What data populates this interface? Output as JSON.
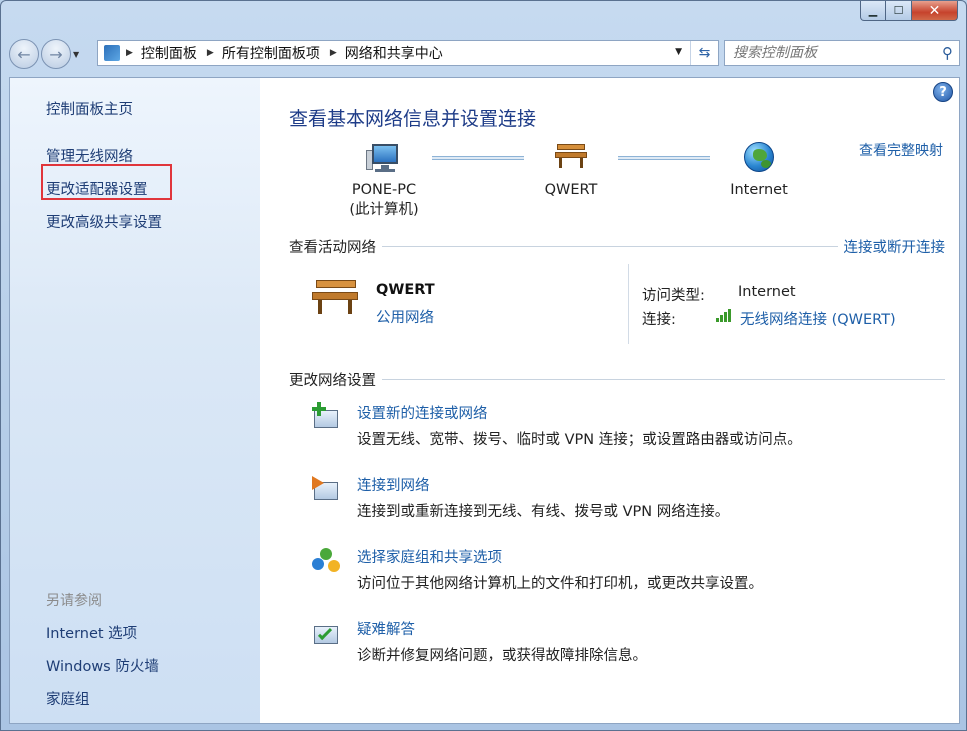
{
  "window": {
    "minimize_glyph": "▁",
    "maximize_glyph": "☐",
    "close_glyph": "✕"
  },
  "nav": {
    "back_glyph": "←",
    "forward_glyph": "→",
    "dropdown_glyph": "▼",
    "breadcrumb": [
      "控制面板",
      "所有控制面板项",
      "网络和共享中心"
    ],
    "breadcrumb_sep": "▶",
    "refresh_glyph": "⇆",
    "search_placeholder": "搜索控制面板",
    "search_glyph": "⚲"
  },
  "sidebar": {
    "home": "控制面板主页",
    "links": [
      "管理无线网络",
      "更改适配器设置",
      "更改高级共享设置"
    ],
    "see_also_header": "另请参阅",
    "see_also": [
      "Internet 选项",
      "Windows 防火墙",
      "家庭组"
    ]
  },
  "main": {
    "help_glyph": "?",
    "title": "查看基本网络信息并设置连接",
    "full_map_link": "查看完整映射",
    "nodes": [
      {
        "label": "PONE-PC",
        "sublabel": "(此计算机)",
        "icon": "computer-icon"
      },
      {
        "label": "QWERT",
        "sublabel": "",
        "icon": "bench-network-icon"
      },
      {
        "label": "Internet",
        "sublabel": "",
        "icon": "globe-icon"
      }
    ],
    "active_header": "查看活动网络",
    "active_link": "连接或断开连接",
    "network": {
      "name": "QWERT",
      "type": "公用网络",
      "access_label": "访问类型:",
      "access_value": "Internet",
      "conn_label": "连接:",
      "conn_value": "无线网络连接 (QWERT)"
    },
    "change_header": "更改网络设置",
    "tasks": [
      {
        "title": "设置新的连接或网络",
        "desc": "设置无线、宽带、拨号、临时或 VPN 连接；或设置路由器或访问点。",
        "icon": "new-connection-icon"
      },
      {
        "title": "连接到网络",
        "desc": "连接到或重新连接到无线、有线、拨号或 VPN 网络连接。",
        "icon": "connect-network-icon"
      },
      {
        "title": "选择家庭组和共享选项",
        "desc": "访问位于其他网络计算机上的文件和打印机，或更改共享设置。",
        "icon": "homegroup-icon"
      },
      {
        "title": "疑难解答",
        "desc": "诊断并修复网络问题，或获得故障排除信息。",
        "icon": "troubleshoot-icon"
      }
    ]
  },
  "colors": {
    "link": "#1e5fa8",
    "title": "#1e3c88",
    "highlight_box": "#e0353b"
  }
}
